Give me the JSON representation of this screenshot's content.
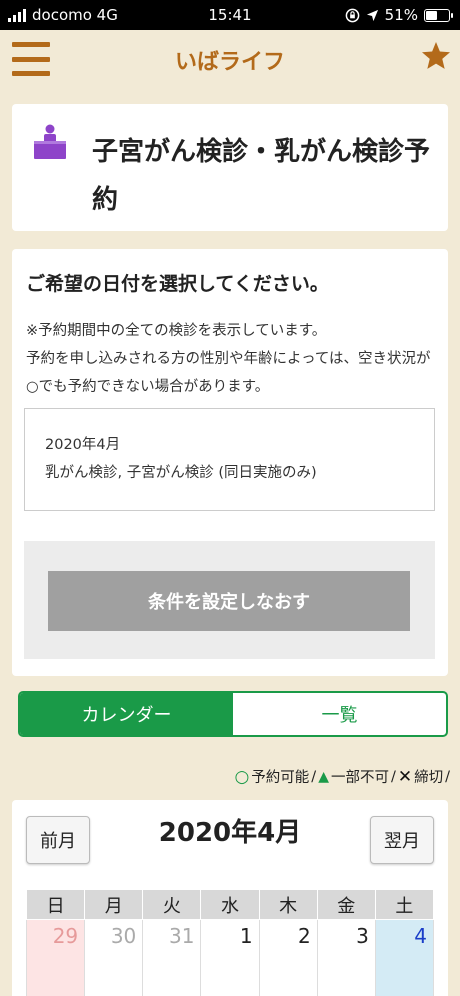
{
  "status_bar": {
    "carrier": "docomo 4G",
    "time": "15:41",
    "battery": "51%"
  },
  "header": {
    "title": "いばライフ",
    "menu_icon": "hamburger-menu-icon",
    "star_icon": "star-icon",
    "accent_color": "#b36a1a"
  },
  "page_title": {
    "text": "子宮がん検診・乳がん検診予約",
    "icon": "person-at-desk-icon"
  },
  "info": {
    "heading": "ご希望の日付を選択してください。",
    "note_line1": "※予約期間中の全ての検診を表示しています。",
    "note_line2": "予約を申し込みされる方の性別や年齢によっては、空き状況が○でも予約できない場合があります。"
  },
  "conditions": {
    "month": "2020年4月",
    "exams": "乳がん検診, 子宮がん検診 (同日実施のみ)"
  },
  "reset_button": {
    "label": "条件を設定しなおす"
  },
  "tabs": [
    {
      "label": "カレンダー",
      "active": true
    },
    {
      "label": "一覧",
      "active": false
    }
  ],
  "legend": {
    "available_symbol": "○",
    "available": "予約可能",
    "partial_symbol": "▲",
    "partial": "一部不可",
    "closed_symbol": "✕",
    "closed": "締切",
    "separator": " /"
  },
  "calendar": {
    "title": "2020年4月",
    "prev_label": "前月",
    "next_label": "翌月",
    "weekdays": [
      "日",
      "月",
      "火",
      "水",
      "木",
      "金",
      "土"
    ],
    "first_row": [
      "29",
      "30",
      "31",
      "1",
      "2",
      "3",
      "4"
    ]
  },
  "colors": {
    "green": "#1a9a48",
    "sunday_bg": "#fde4e4",
    "saturday_bg": "#d4ebf5"
  }
}
